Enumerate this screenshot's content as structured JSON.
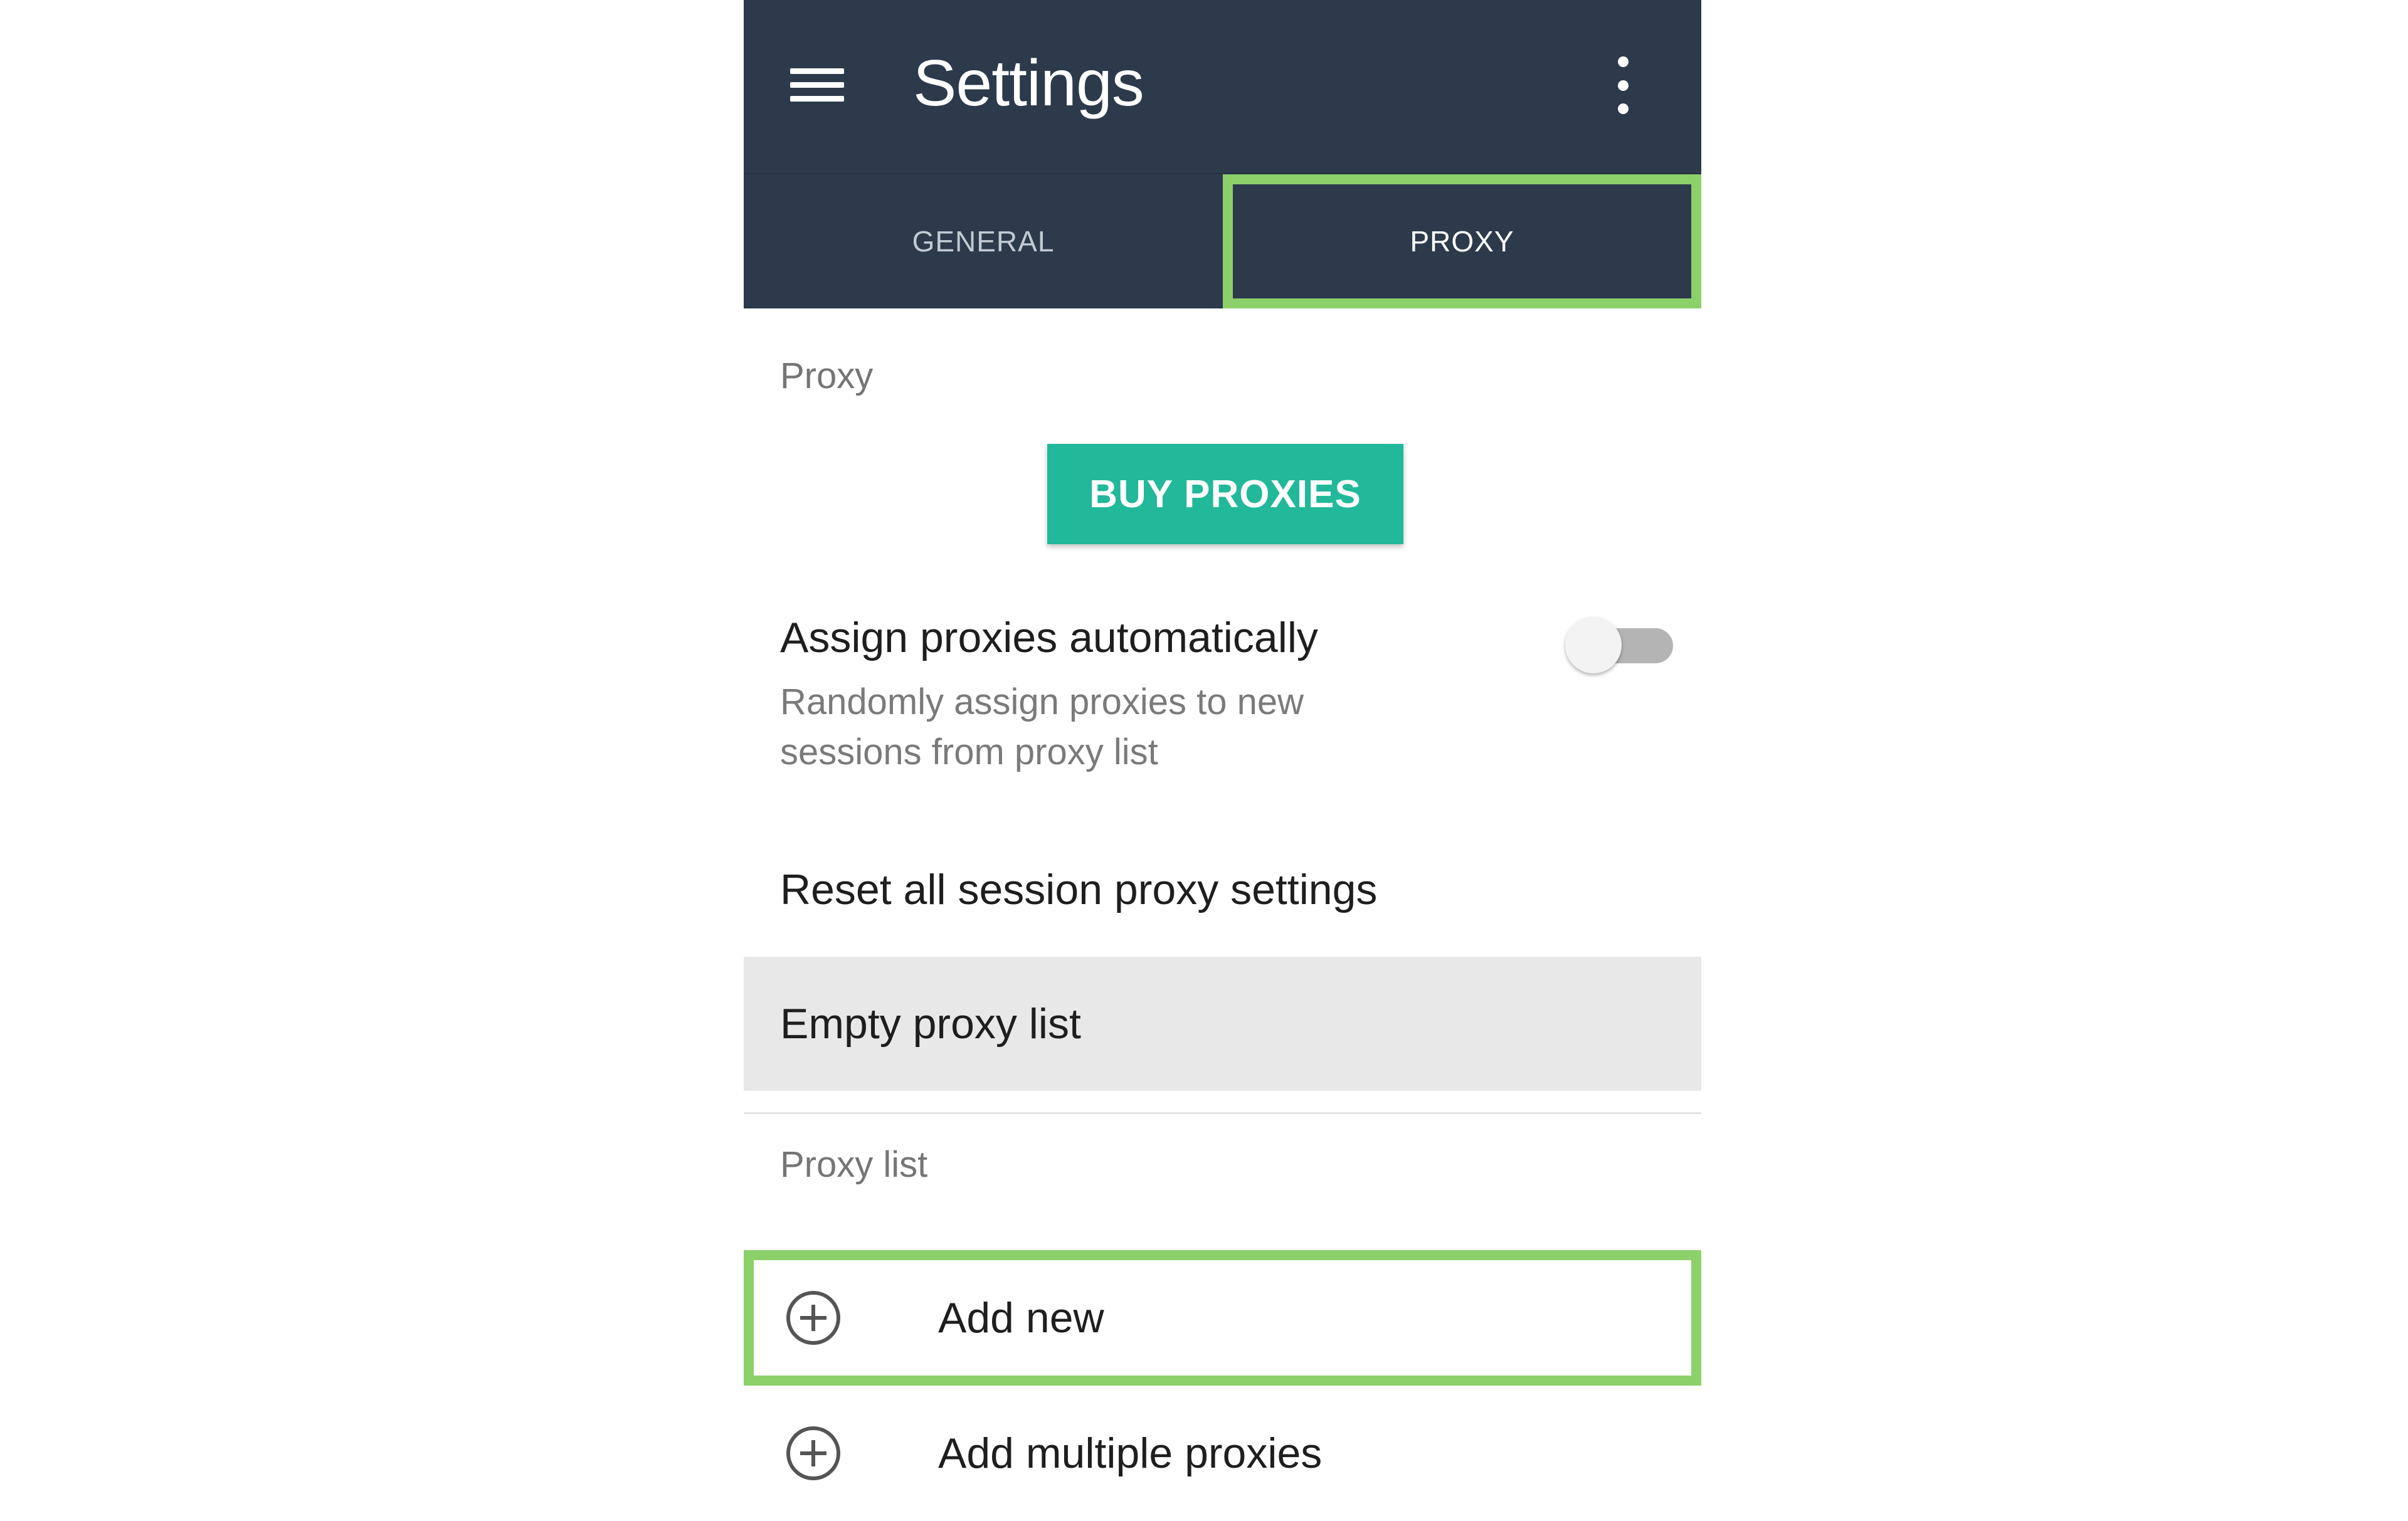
{
  "appbar": {
    "title": "Settings"
  },
  "tabs": [
    {
      "label": "GENERAL",
      "active": false
    },
    {
      "label": "PROXY",
      "active": true
    }
  ],
  "proxy_section": {
    "label": "Proxy",
    "buy_button": "BUY PROXIES",
    "auto_assign": {
      "title": "Assign proxies automatically",
      "description": "Randomly assign proxies to new sessions from proxy list",
      "enabled": false
    },
    "reset_label": "Reset all session proxy settings",
    "empty_label": "Empty proxy list"
  },
  "proxy_list": {
    "label": "Proxy list",
    "items": [
      {
        "label": "Add new",
        "icon": "plus-circle-icon",
        "highlighted": true
      },
      {
        "label": "Add multiple proxies",
        "icon": "plus-circle-icon",
        "highlighted": false
      }
    ]
  },
  "colors": {
    "appbar": "#2c3a4b",
    "accent_button": "#22b89a",
    "highlight": "#8cd06a",
    "row_pressed": "#e8e8e8"
  }
}
